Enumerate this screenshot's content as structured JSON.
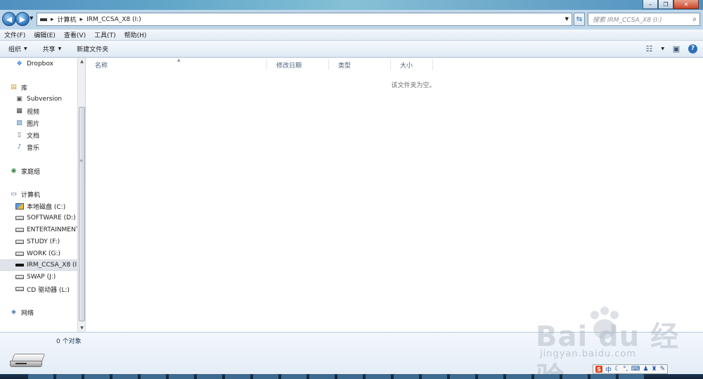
{
  "address": {
    "segments": [
      "计算机",
      "IRM_CCSA_X8 (I:)"
    ],
    "separator": "▸",
    "search_placeholder": "搜索 IRM_CCSA_X8 (I:)"
  },
  "menu": [
    "文件(F)",
    "编辑(E)",
    "查看(V)",
    "工具(T)",
    "帮助(H)"
  ],
  "toolbar": {
    "organize": "组织",
    "share": "共享",
    "new_folder": "新建文件夹"
  },
  "nav": {
    "favorites": [
      {
        "label": "Dropbox",
        "icon": "dropbox-icon"
      }
    ],
    "libraries_header": "库",
    "libraries": [
      {
        "label": "Subversion",
        "icon": "subversion-icon"
      },
      {
        "label": "视频",
        "icon": "video-icon"
      },
      {
        "label": "图片",
        "icon": "picture-icon"
      },
      {
        "label": "文档",
        "icon": "document-icon"
      },
      {
        "label": "音乐",
        "icon": "music-icon"
      }
    ],
    "homegroup": "家庭组",
    "computer_header": "计算机",
    "drives": [
      {
        "label": "本地磁盘 (C:)",
        "type": "system"
      },
      {
        "label": "SOFTWARE (D:)",
        "type": "hdd"
      },
      {
        "label": "ENTERTAINMENT",
        "type": "hdd"
      },
      {
        "label": "STUDY (F:)",
        "type": "hdd"
      },
      {
        "label": "WORK (G:)",
        "type": "hdd"
      },
      {
        "label": "IRM_CCSA_X8 (I:)",
        "type": "removable",
        "selected": true
      },
      {
        "label": "SWAP (J:)",
        "type": "hdd"
      },
      {
        "label": "CD 驱动器 (L:)",
        "type": "cd"
      }
    ],
    "network": "网络"
  },
  "columns": [
    "名称",
    "修改日期",
    "类型",
    "大小"
  ],
  "empty_message": "该文件夹为空。",
  "status": {
    "count": "0 个对象"
  },
  "ime": {
    "label": "中",
    "badge": "S"
  },
  "watermark": {
    "logo": "Bai du 经验",
    "url": "jingyan.baidu.com"
  }
}
